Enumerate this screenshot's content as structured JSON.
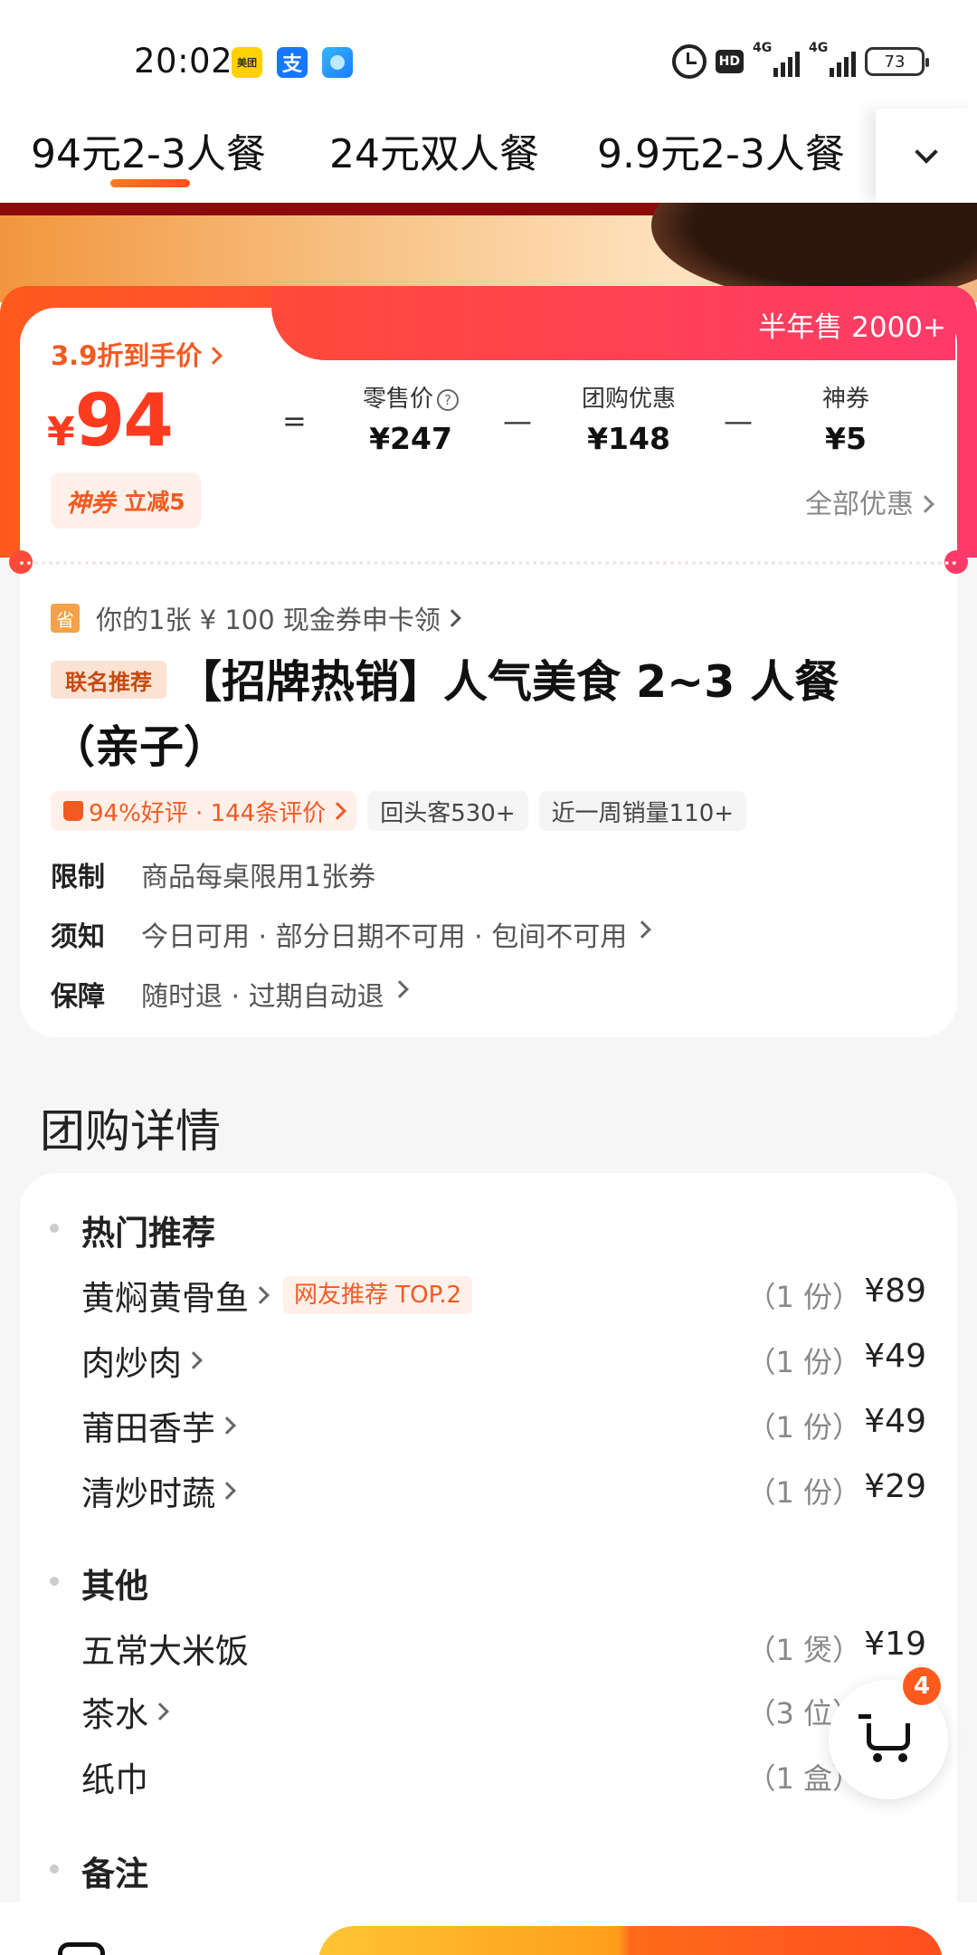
{
  "status_bar": {
    "time": "20:02",
    "apps": [
      "美团",
      "支",
      "app"
    ],
    "hd": "HD",
    "sig1": "4G",
    "sig2": "4G",
    "battery": "73"
  },
  "tabs": [
    {
      "label": "94元2-3人餐",
      "active": true
    },
    {
      "label": "24元双人餐",
      "active": false
    },
    {
      "label": "9.9元2-3人餐",
      "active": false
    }
  ],
  "price": {
    "sold": "半年售 2000+",
    "discount_label": "3.9折到手价",
    "yen": "¥",
    "amount": "94",
    "eq": "=",
    "minus": "—",
    "retail_label": "零售价",
    "retail_value": "¥247",
    "group_label": "团购优惠",
    "group_value": "¥148",
    "coupon_label": "神券",
    "coupon_value": "¥5",
    "chip_a": "神券",
    "chip_b": "立减5",
    "all_offers": "全部优惠",
    "accent": "#ff3b1f"
  },
  "deal": {
    "sheng": "省",
    "cashback": "你的1张 ¥ 100 现金券申卡领",
    "badge": "联名推荐",
    "title": "【招牌热销】人气美食 2~3 人餐（亲子）",
    "tag_rating": "94%好评 · 144条评价",
    "tag_repeat": "回头客530+",
    "tag_sales": "近一周销量110+",
    "rules": [
      {
        "key": "限制",
        "value": "商品每桌限用1张券"
      },
      {
        "key": "须知",
        "value": "今日可用 · 部分日期不可用  ·  包间不可用"
      },
      {
        "key": "保障",
        "value": "随时退  ·  过期自动退"
      }
    ]
  },
  "details": {
    "section_title": "团购详情",
    "groups": [
      {
        "name": "热门推荐",
        "items": [
          {
            "name": "黄焖黄骨鱼",
            "badge": "网友推荐 TOP.2",
            "qty": "（1 份）",
            "price": "¥89"
          },
          {
            "name": "肉炒肉",
            "qty": "（1 份）",
            "price": "¥49"
          },
          {
            "name": "莆田香芋",
            "qty": "（1 份）",
            "price": "¥49"
          },
          {
            "name": "清炒时蔬",
            "qty": "（1 份）",
            "price": "¥29"
          }
        ]
      },
      {
        "name": "其他",
        "items": [
          {
            "name": "五常大米饭",
            "qty": "（1 煲）",
            "price": "¥19"
          },
          {
            "name": "茶水",
            "qty": "（3 位）",
            "price": ""
          },
          {
            "name": "纸巾",
            "qty": "（1 盒）",
            "price": ""
          }
        ]
      },
      {
        "name": "备注"
      }
    ]
  },
  "cart": {
    "count": "4"
  }
}
